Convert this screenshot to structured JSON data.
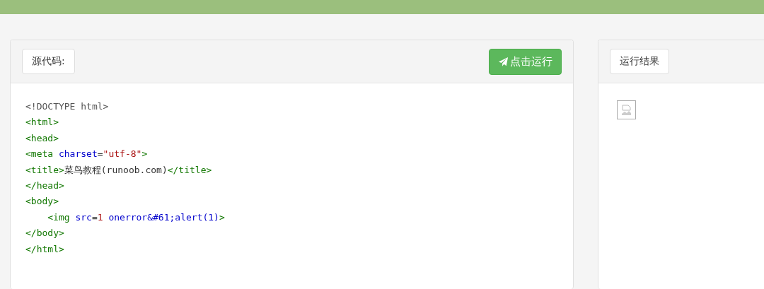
{
  "source_panel": {
    "label": "源代码:",
    "run_button": {
      "label": "点击运行"
    },
    "code_lines": [
      {
        "tokens": [
          {
            "kind": "doctype",
            "text": "<!DOCTYPE html>"
          }
        ]
      },
      {
        "tokens": [
          {
            "kind": "tag",
            "text": "<html>"
          }
        ]
      },
      {
        "tokens": [
          {
            "kind": "tag",
            "text": "<head>"
          }
        ]
      },
      {
        "tokens": [
          {
            "kind": "tag",
            "text": "<meta "
          },
          {
            "kind": "attr",
            "text": "charset"
          },
          {
            "kind": "plain",
            "text": "="
          },
          {
            "kind": "string",
            "text": "\"utf-8\""
          },
          {
            "kind": "tag",
            "text": ">"
          }
        ]
      },
      {
        "tokens": [
          {
            "kind": "tag",
            "text": "<title>"
          },
          {
            "kind": "plain",
            "text": "菜鸟教程(runoob.com)"
          },
          {
            "kind": "tag",
            "text": "</title>"
          }
        ]
      },
      {
        "tokens": [
          {
            "kind": "tag",
            "text": "</head>"
          }
        ]
      },
      {
        "tokens": [
          {
            "kind": "tag",
            "text": "<body>"
          }
        ]
      },
      {
        "indent": true,
        "tokens": [
          {
            "kind": "tag",
            "text": "<img "
          },
          {
            "kind": "attr",
            "text": "src"
          },
          {
            "kind": "plain",
            "text": "="
          },
          {
            "kind": "string",
            "text": "1 "
          },
          {
            "kind": "attr",
            "text": "onerror&#61;alert(1)"
          },
          {
            "kind": "tag",
            "text": ">"
          }
        ]
      },
      {
        "tokens": [
          {
            "kind": "tag",
            "text": "</body>"
          }
        ]
      },
      {
        "tokens": [
          {
            "kind": "tag",
            "text": "</html>"
          }
        ]
      }
    ]
  },
  "result_panel": {
    "label": "运行结果"
  }
}
